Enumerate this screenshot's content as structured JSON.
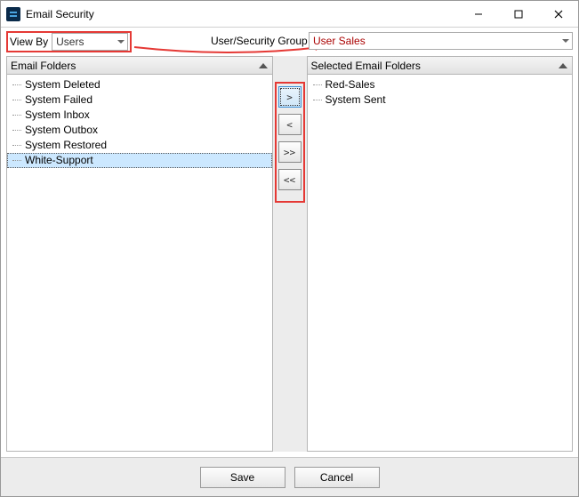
{
  "window": {
    "title": "Email Security"
  },
  "toprow": {
    "view_by_label": "View By",
    "view_by_value": "Users",
    "usg_label": "User/Security Group",
    "usg_value": "User Sales"
  },
  "left_panel": {
    "header": "Email Folders",
    "items": [
      {
        "label": "System Deleted"
      },
      {
        "label": "System Failed"
      },
      {
        "label": "System Inbox"
      },
      {
        "label": "System Outbox"
      },
      {
        "label": "System Restored"
      },
      {
        "label": "White-Support"
      }
    ],
    "selected_index": 5
  },
  "right_panel": {
    "header": "Selected Email Folders",
    "items": [
      {
        "label": "Red-Sales"
      },
      {
        "label": "System Sent"
      }
    ]
  },
  "move_buttons": {
    "add": ">",
    "remove": "<",
    "add_all": ">>",
    "remove_all": "<<"
  },
  "bottom": {
    "save": "Save",
    "cancel": "Cancel"
  }
}
